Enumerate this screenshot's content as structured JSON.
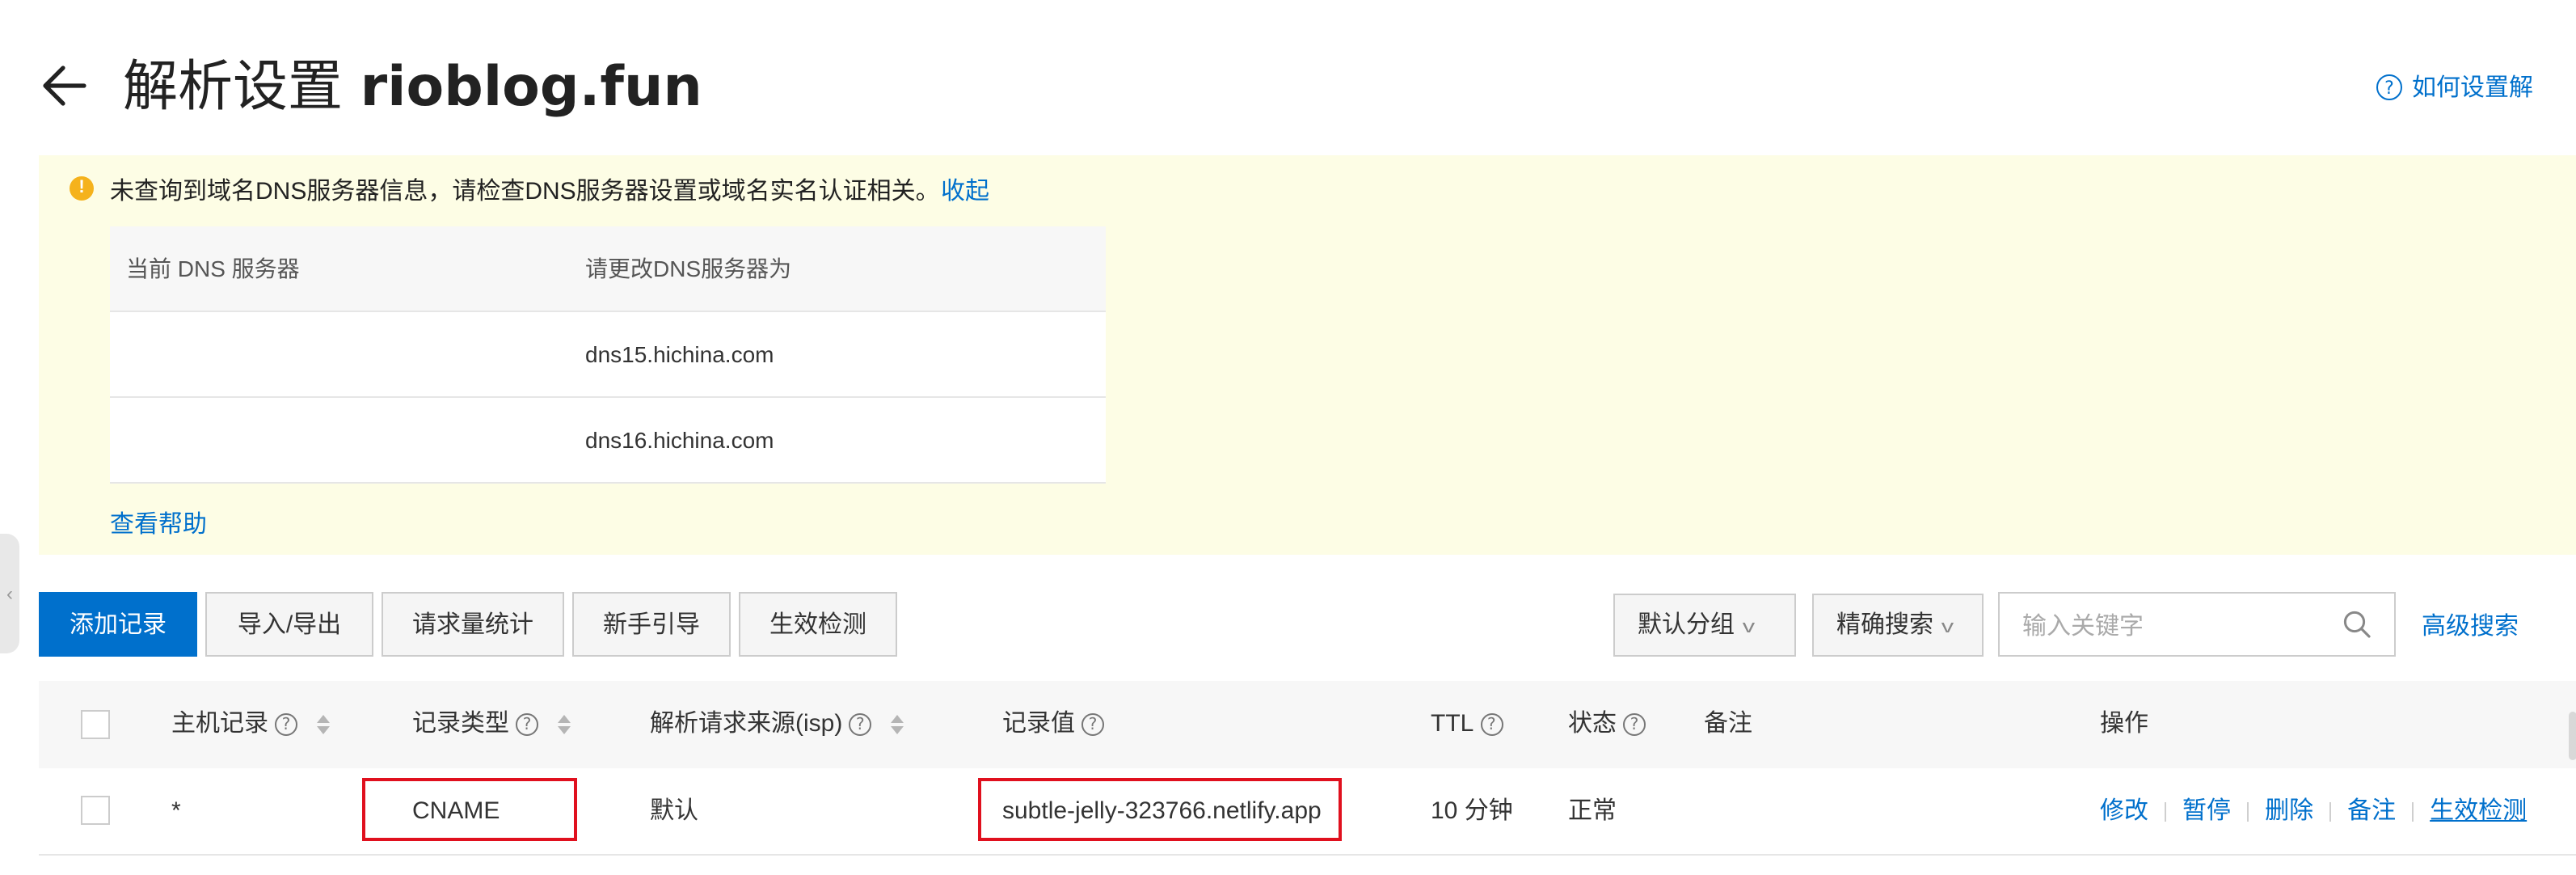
{
  "header": {
    "title_prefix": "解析设置",
    "domain": "rioblog.fun",
    "help_link": "如何设置解"
  },
  "alert": {
    "message": "未查询到域名DNS服务器信息，请检查DNS服务器设置或域名实名认证相关。",
    "collapse_label": "收起",
    "table": {
      "headers": [
        "当前 DNS 服务器",
        "请更改DNS服务器为"
      ],
      "rows": [
        [
          "",
          "dns15.hichina.com"
        ],
        [
          "",
          "dns16.hichina.com"
        ]
      ]
    },
    "help_label": "查看帮助"
  },
  "toolbar": {
    "add_record": "添加记录",
    "import_export": "导入/导出",
    "request_stats": "请求量统计",
    "beginner_guide": "新手引导",
    "effect_check": "生效检测",
    "group_select": "默认分组",
    "search_mode": "精确搜索",
    "search_placeholder": "输入关键字",
    "advanced_search": "高级搜索"
  },
  "table": {
    "columns": {
      "host": "主机记录",
      "type": "记录类型",
      "isp": "解析请求来源(isp)",
      "value": "记录值",
      "ttl": "TTL",
      "status": "状态",
      "remark": "备注",
      "actions": "操作"
    },
    "rows": [
      {
        "host": "*",
        "type": "CNAME",
        "isp": "默认",
        "value": "subtle-jelly-323766.netlify.app",
        "ttl": "10 分钟",
        "status": "正常",
        "remark": "",
        "actions": [
          "修改",
          "暂停",
          "删除",
          "备注",
          "生效检测"
        ]
      }
    ]
  },
  "colors": {
    "primary": "#0070cc",
    "alert_bg": "#fdfde5",
    "status_ok": "#1e9e3a",
    "highlight_box": "#e0101e"
  }
}
